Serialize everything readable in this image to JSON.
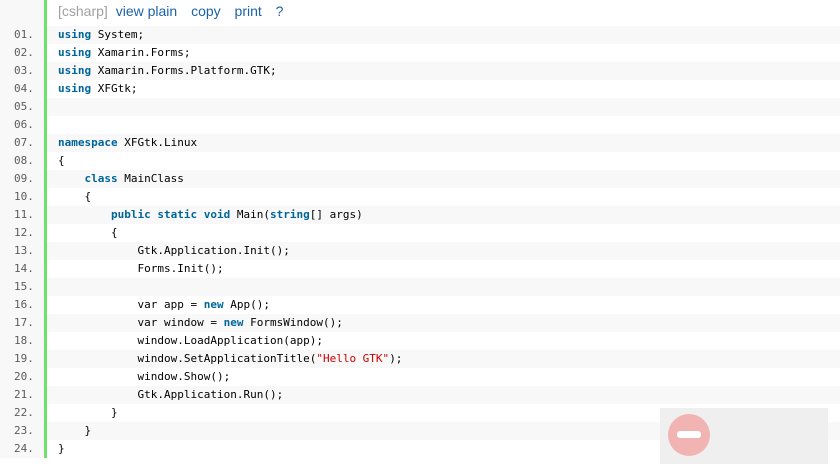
{
  "toolbar": {
    "language": "[csharp]",
    "view_plain": "view plain",
    "copy": "copy",
    "print": "print",
    "help": "?"
  },
  "lines": [
    {
      "num": "01.",
      "text": "using System;"
    },
    {
      "num": "02.",
      "text": "using Xamarin.Forms;"
    },
    {
      "num": "03.",
      "text": "using Xamarin.Forms.Platform.GTK;"
    },
    {
      "num": "04.",
      "text": "using XFGtk;"
    },
    {
      "num": "05.",
      "text": ""
    },
    {
      "num": "06.",
      "text": ""
    },
    {
      "num": "07.",
      "text": "namespace XFGtk.Linux"
    },
    {
      "num": "08.",
      "text": "{"
    },
    {
      "num": "09.",
      "text": "    class MainClass"
    },
    {
      "num": "10.",
      "text": "    {"
    },
    {
      "num": "11.",
      "text": "        public static void Main(string[] args)"
    },
    {
      "num": "12.",
      "text": "        {"
    },
    {
      "num": "13.",
      "text": "            Gtk.Application.Init();"
    },
    {
      "num": "14.",
      "text": "            Forms.Init();"
    },
    {
      "num": "15.",
      "text": ""
    },
    {
      "num": "16.",
      "text": "            var app = new App();"
    },
    {
      "num": "17.",
      "text": "            var window = new FormsWindow();"
    },
    {
      "num": "18.",
      "text": "            window.LoadApplication(app);"
    },
    {
      "num": "19.",
      "text": "            window.SetApplicationTitle(\"Hello GTK\");"
    },
    {
      "num": "20.",
      "text": "            window.Show();"
    },
    {
      "num": "21.",
      "text": "            Gtk.Application.Run();"
    },
    {
      "num": "22.",
      "text": "        }"
    },
    {
      "num": "23.",
      "text": "    }"
    },
    {
      "num": "24.",
      "text": "}"
    }
  ],
  "keywords": [
    "using",
    "namespace",
    "class",
    "public",
    "static",
    "void",
    "string",
    "new"
  ],
  "colors": {
    "keyword": "#006699",
    "string": "#cc0000",
    "gutter_bar": "#6ce26c",
    "link": "#1a62a8"
  }
}
